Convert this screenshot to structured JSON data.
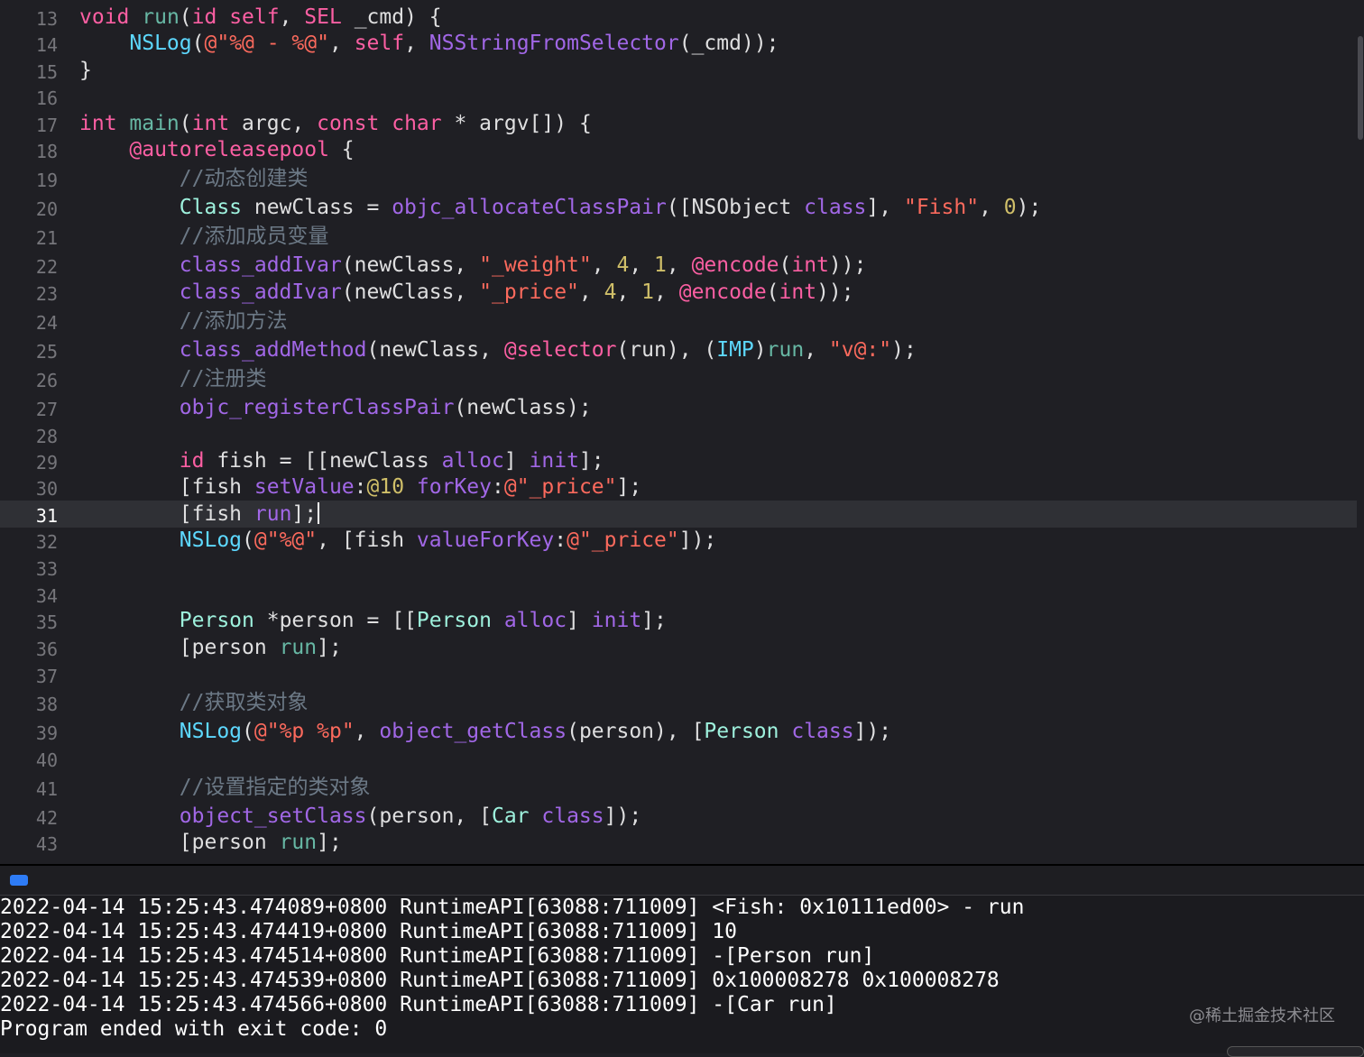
{
  "editor": {
    "current_line": "31",
    "lines": [
      {
        "n": "13",
        "tokens": [
          [
            "void ",
            "kw"
          ],
          [
            "run",
            "fn"
          ],
          [
            "(",
            "pl"
          ],
          [
            "id ",
            "kw"
          ],
          [
            "self",
            "kw"
          ],
          [
            ", ",
            "pl"
          ],
          [
            "SEL ",
            "kw"
          ],
          [
            "_cmd) {",
            "pl"
          ]
        ]
      },
      {
        "n": "14",
        "tokens": [
          [
            "    ",
            "pl"
          ],
          [
            "NSLog",
            "ty"
          ],
          [
            "(",
            "pl"
          ],
          [
            "@\"%@ - %@\"",
            "str"
          ],
          [
            ", ",
            "pl"
          ],
          [
            "self",
            "kw"
          ],
          [
            ", ",
            "pl"
          ],
          [
            "NSStringFromSelector",
            "fn2"
          ],
          [
            "(_cmd));",
            "pl"
          ]
        ]
      },
      {
        "n": "15",
        "tokens": [
          [
            "}",
            "pl"
          ]
        ]
      },
      {
        "n": "16",
        "tokens": []
      },
      {
        "n": "17",
        "tokens": [
          [
            "int ",
            "kw"
          ],
          [
            "main",
            "fn"
          ],
          [
            "(",
            "pl"
          ],
          [
            "int ",
            "kw"
          ],
          [
            "argc, ",
            "pl"
          ],
          [
            "const ",
            "kw"
          ],
          [
            "char ",
            "kw"
          ],
          [
            "* argv[]) {",
            "pl"
          ]
        ]
      },
      {
        "n": "18",
        "tokens": [
          [
            "    ",
            "pl"
          ],
          [
            "@autoreleasepool",
            "kw"
          ],
          [
            " {",
            "pl"
          ]
        ]
      },
      {
        "n": "19",
        "tokens": [
          [
            "        ",
            "pl"
          ],
          [
            "//",
            "com"
          ],
          [
            "动态创建类",
            "cjk"
          ]
        ]
      },
      {
        "n": "20",
        "tokens": [
          [
            "        ",
            "pl"
          ],
          [
            "Class ",
            "ty2"
          ],
          [
            "newClass = ",
            "pl"
          ],
          [
            "objc_allocateClassPair",
            "fn2"
          ],
          [
            "([",
            "pl"
          ],
          [
            "NSObject ",
            "pl"
          ],
          [
            "class",
            "fn2"
          ],
          [
            "], ",
            "pl"
          ],
          [
            "\"Fish\"",
            "str"
          ],
          [
            ", ",
            "pl"
          ],
          [
            "0",
            "num"
          ],
          [
            ");",
            "pl"
          ]
        ]
      },
      {
        "n": "21",
        "tokens": [
          [
            "        ",
            "pl"
          ],
          [
            "//",
            "com"
          ],
          [
            "添加成员变量",
            "cjk"
          ]
        ]
      },
      {
        "n": "22",
        "tokens": [
          [
            "        ",
            "pl"
          ],
          [
            "class_addIvar",
            "fn2"
          ],
          [
            "(newClass, ",
            "pl"
          ],
          [
            "\"_weight\"",
            "str"
          ],
          [
            ", ",
            "pl"
          ],
          [
            "4",
            "num"
          ],
          [
            ", ",
            "pl"
          ],
          [
            "1",
            "num"
          ],
          [
            ", ",
            "pl"
          ],
          [
            "@encode",
            "kw"
          ],
          [
            "(",
            "pl"
          ],
          [
            "int",
            "kw"
          ],
          [
            "));",
            "pl"
          ]
        ]
      },
      {
        "n": "23",
        "tokens": [
          [
            "        ",
            "pl"
          ],
          [
            "class_addIvar",
            "fn2"
          ],
          [
            "(newClass, ",
            "pl"
          ],
          [
            "\"_price\"",
            "str"
          ],
          [
            ", ",
            "pl"
          ],
          [
            "4",
            "num"
          ],
          [
            ", ",
            "pl"
          ],
          [
            "1",
            "num"
          ],
          [
            ", ",
            "pl"
          ],
          [
            "@encode",
            "kw"
          ],
          [
            "(",
            "pl"
          ],
          [
            "int",
            "kw"
          ],
          [
            "));",
            "pl"
          ]
        ]
      },
      {
        "n": "24",
        "tokens": [
          [
            "        ",
            "pl"
          ],
          [
            "//",
            "com"
          ],
          [
            "添加方法",
            "cjk"
          ]
        ]
      },
      {
        "n": "25",
        "tokens": [
          [
            "        ",
            "pl"
          ],
          [
            "class_addMethod",
            "fn2"
          ],
          [
            "(newClass, ",
            "pl"
          ],
          [
            "@selector",
            "kw"
          ],
          [
            "(run), (",
            "pl"
          ],
          [
            "IMP",
            "ty"
          ],
          [
            ")",
            "pl"
          ],
          [
            "run",
            "fn"
          ],
          [
            ", ",
            "pl"
          ],
          [
            "\"v@:\"",
            "str"
          ],
          [
            ");",
            "pl"
          ]
        ]
      },
      {
        "n": "26",
        "tokens": [
          [
            "        ",
            "pl"
          ],
          [
            "//",
            "com"
          ],
          [
            "注册类",
            "cjk"
          ]
        ]
      },
      {
        "n": "27",
        "tokens": [
          [
            "        ",
            "pl"
          ],
          [
            "objc_registerClassPair",
            "fn2"
          ],
          [
            "(newClass);",
            "pl"
          ]
        ]
      },
      {
        "n": "28",
        "tokens": []
      },
      {
        "n": "29",
        "tokens": [
          [
            "        ",
            "pl"
          ],
          [
            "id ",
            "kw"
          ],
          [
            "fish = [[newClass ",
            "pl"
          ],
          [
            "alloc",
            "fn2"
          ],
          [
            "] ",
            "pl"
          ],
          [
            "init",
            "fn2"
          ],
          [
            "];",
            "pl"
          ]
        ]
      },
      {
        "n": "30",
        "tokens": [
          [
            "        ",
            "pl"
          ],
          [
            "[fish ",
            "pl"
          ],
          [
            "setValue",
            "fn2"
          ],
          [
            ":",
            "pl"
          ],
          [
            "@10",
            "num"
          ],
          [
            " ",
            "pl"
          ],
          [
            "forKey",
            "fn2"
          ],
          [
            ":",
            "pl"
          ],
          [
            "@\"_price\"",
            "str"
          ],
          [
            "];",
            "pl"
          ]
        ]
      },
      {
        "n": "31",
        "tokens": [
          [
            "        ",
            "pl"
          ],
          [
            "[fish ",
            "pl"
          ],
          [
            "run",
            "fn2"
          ],
          [
            "];",
            "pl"
          ]
        ],
        "cursor": true
      },
      {
        "n": "32",
        "tokens": [
          [
            "        ",
            "pl"
          ],
          [
            "NSLog",
            "ty"
          ],
          [
            "(",
            "pl"
          ],
          [
            "@\"%@\"",
            "str"
          ],
          [
            ", [fish ",
            "pl"
          ],
          [
            "valueForKey",
            "fn2"
          ],
          [
            ":",
            "pl"
          ],
          [
            "@\"_price\"",
            "str"
          ],
          [
            "]);",
            "pl"
          ]
        ]
      },
      {
        "n": "33",
        "tokens": []
      },
      {
        "n": "34",
        "tokens": []
      },
      {
        "n": "35",
        "tokens": [
          [
            "        ",
            "pl"
          ],
          [
            "Person ",
            "ty2"
          ],
          [
            "*person = [[",
            "pl"
          ],
          [
            "Person ",
            "ty2"
          ],
          [
            "alloc",
            "fn2"
          ],
          [
            "] ",
            "pl"
          ],
          [
            "init",
            "fn2"
          ],
          [
            "];",
            "pl"
          ]
        ]
      },
      {
        "n": "36",
        "tokens": [
          [
            "        ",
            "pl"
          ],
          [
            "[person ",
            "pl"
          ],
          [
            "run",
            "fn"
          ],
          [
            "];",
            "pl"
          ]
        ]
      },
      {
        "n": "37",
        "tokens": []
      },
      {
        "n": "38",
        "tokens": [
          [
            "        ",
            "pl"
          ],
          [
            "//",
            "com"
          ],
          [
            "获取类对象",
            "cjk"
          ]
        ]
      },
      {
        "n": "39",
        "tokens": [
          [
            "        ",
            "pl"
          ],
          [
            "NSLog",
            "ty"
          ],
          [
            "(",
            "pl"
          ],
          [
            "@\"%p %p\"",
            "str"
          ],
          [
            ", ",
            "pl"
          ],
          [
            "object_getClass",
            "fn2"
          ],
          [
            "(person), [",
            "pl"
          ],
          [
            "Person ",
            "ty2"
          ],
          [
            "class",
            "fn2"
          ],
          [
            "]);",
            "pl"
          ]
        ]
      },
      {
        "n": "40",
        "tokens": []
      },
      {
        "n": "41",
        "tokens": [
          [
            "        ",
            "pl"
          ],
          [
            "//",
            "com"
          ],
          [
            "设置指定的类对象",
            "cjk"
          ]
        ]
      },
      {
        "n": "42",
        "tokens": [
          [
            "        ",
            "pl"
          ],
          [
            "object_setClass",
            "fn2"
          ],
          [
            "(person, [",
            "pl"
          ],
          [
            "Car ",
            "ty2"
          ],
          [
            "class",
            "fn2"
          ],
          [
            "]);",
            "pl"
          ]
        ]
      },
      {
        "n": "43",
        "tokens": [
          [
            "        ",
            "pl"
          ],
          [
            "[person ",
            "pl"
          ],
          [
            "run",
            "fn"
          ],
          [
            "];",
            "pl"
          ]
        ]
      }
    ]
  },
  "console": {
    "lines": [
      "2022-04-14 15:25:43.474089+0800 RuntimeAPI[63088:711009] <Fish: 0x10111ed00> - run",
      "2022-04-14 15:25:43.474419+0800 RuntimeAPI[63088:711009] 10",
      "2022-04-14 15:25:43.474514+0800 RuntimeAPI[63088:711009] -[Person run]",
      "2022-04-14 15:25:43.474539+0800 RuntimeAPI[63088:711009] 0x100008278 0x100008278",
      "2022-04-14 15:25:43.474566+0800 RuntimeAPI[63088:711009] -[Car run]",
      "Program ended with exit code: 0"
    ]
  },
  "watermark": "@稀土掘金技术社区",
  "icons": {
    "debug_toggle": "debug-area-toggle-icon"
  }
}
